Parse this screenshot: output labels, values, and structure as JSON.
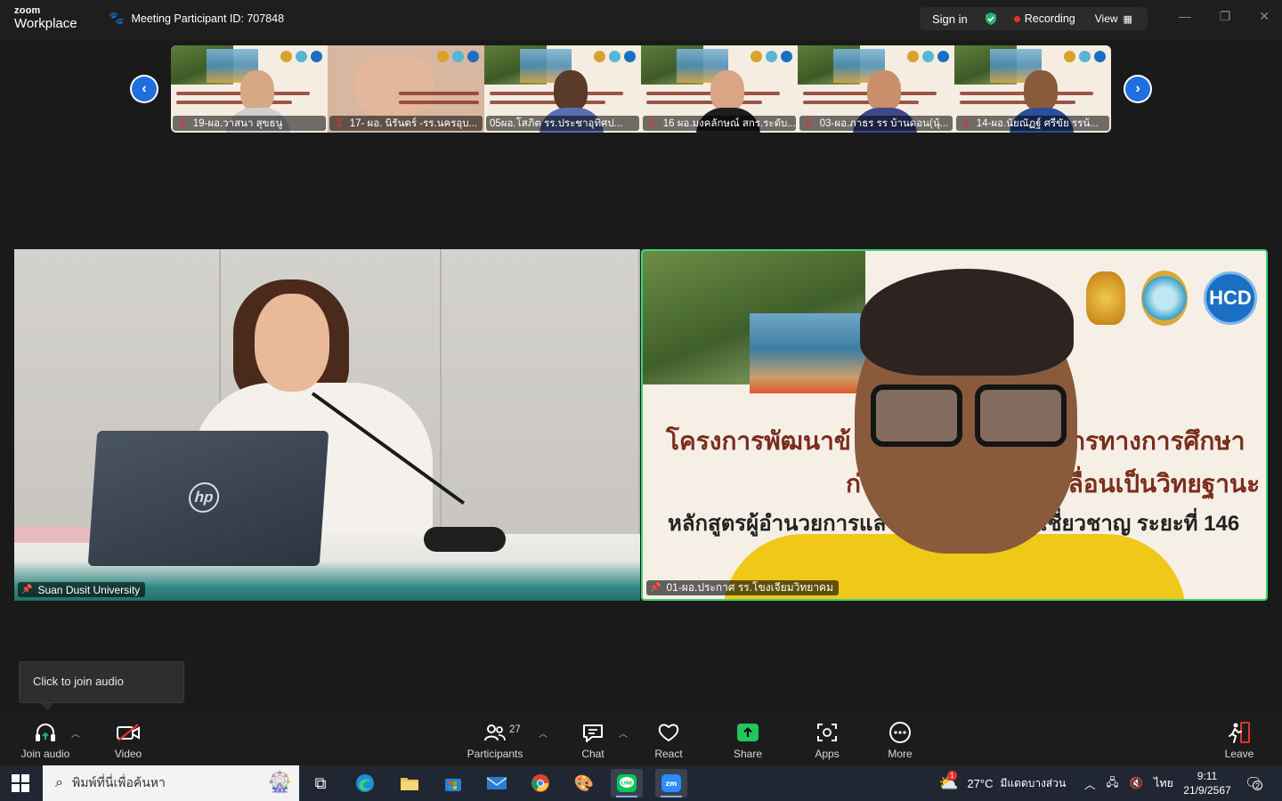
{
  "titlebar": {
    "brand_top": "zoom",
    "brand_bottom": "Workplace",
    "meeting_id": "Meeting Participant ID: 707848",
    "sign_in": "Sign in",
    "recording": "Recording",
    "view": "View"
  },
  "filmstrip": {
    "participants": [
      {
        "name": "19-ผอ.วาสนา สุขธนู"
      },
      {
        "name": "17- ผอ. นิรันดร์ -รร.นครอุบ..."
      },
      {
        "name": "05ผอ.โสภิต  รร.ประชาอุทิศป..."
      },
      {
        "name": "16 ผอ.มงคลักษณ์ สกร.ระดับ..."
      },
      {
        "name": "03-ผอ.ภาธร รร บ้านดอน(นุ้..."
      },
      {
        "name": "14-ผอ.นัยณัฏฐ์ ศรีขัย รรน้..."
      }
    ]
  },
  "main_videos": {
    "left_label": "Suan Dusit University",
    "right_label": "01-ผอ.ประกาศ รร.โขงเจียมวิทยาคม",
    "laptop_logo": "hp",
    "slide_logo_text": "HCD",
    "slide_line1_left": "โครงการพัฒนาข้",
    "slide_line1_right": "กรทางการศึกษา",
    "slide_line2_left": "ก่",
    "slide_line2_right": "เลื่อนเป็นวิทยฐานะ",
    "slide_line3_left": "หลักสูตรผู้อำนวยการแล",
    "slide_line3_right": "เชี่ยวชาญ ระยะที่ 146"
  },
  "tooltip": {
    "text": "Click to join audio"
  },
  "toolbar": {
    "join_audio": "Join audio",
    "video": "Video",
    "participants": "Participants",
    "participants_count": "27",
    "chat": "Chat",
    "react": "React",
    "share": "Share",
    "apps": "Apps",
    "more": "More",
    "leave": "Leave"
  },
  "taskbar": {
    "search_placeholder": "พิมพ์ที่นี่เพื่อค้นหา",
    "weather_temp": "27°C",
    "weather_desc": "มีแดดบางส่วน",
    "weather_badge": "1",
    "language": "ไทย",
    "time": "9:11",
    "date": "21/9/2567",
    "notification_count": "2"
  },
  "colors": {
    "accent_blue": "#1e6fe0",
    "recording_red": "#e5322e",
    "active_speaker_green": "#3ed27a",
    "share_green": "#22c55e"
  }
}
